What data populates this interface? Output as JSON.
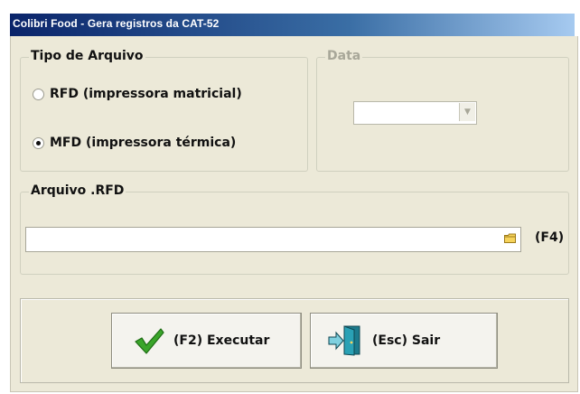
{
  "window": {
    "title": "Colibri Food - Gera registros da CAT-52"
  },
  "tipo_arquivo": {
    "legend": "Tipo de Arquivo",
    "options": [
      {
        "label": "RFD (impressora matricial)",
        "checked": false
      },
      {
        "label": "MFD (impressora térmica)",
        "checked": true
      }
    ]
  },
  "data_group": {
    "legend": "Data",
    "value": "",
    "enabled": false
  },
  "arquivo": {
    "legend": "Arquivo .RFD",
    "value": "",
    "shortcut": "(F4)",
    "browse_icon": "folder-icon"
  },
  "buttons": {
    "executar": {
      "label": "(F2) Executar",
      "icon": "checkmark-icon",
      "icon_color": "#3aa52a"
    },
    "sair": {
      "label": "(Esc) Sair",
      "icon": "exit-door-icon",
      "icon_color": "#1c7a8c"
    }
  }
}
